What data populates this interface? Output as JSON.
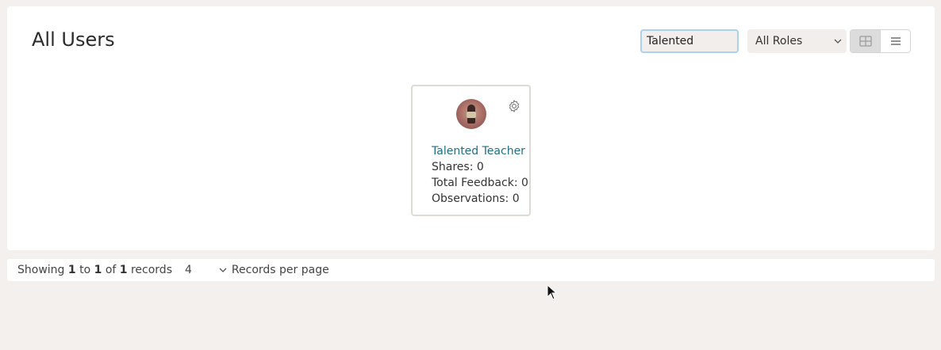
{
  "header": {
    "title": "All Users",
    "search_value": "Talented",
    "role_filter": "All Roles"
  },
  "view_toggle": {
    "active": "grid"
  },
  "users": [
    {
      "name": "Talented Teacher",
      "shares": "Shares: 0",
      "feedback": "Total Feedback: 0",
      "observations": "Observations: 0"
    }
  ],
  "footer": {
    "showing": "Showing",
    "from": "1",
    "to_word": "to",
    "to": "1",
    "of_word": "of",
    "total": "1",
    "records_word": "records",
    "per_page_value": "4",
    "per_page_label": "Records per page"
  },
  "icons": [
    "gear-icon",
    "grid-view-icon",
    "list-view-icon",
    "chevron-down-icon"
  ]
}
